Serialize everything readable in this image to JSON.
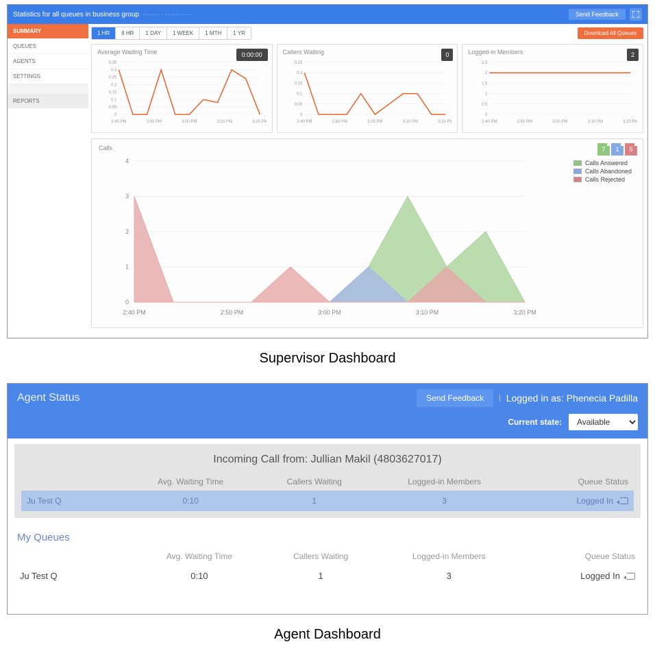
{
  "supervisor": {
    "header_title": "Statistics for all queues in business group",
    "send_feedback": "Send Feedback",
    "sidebar": {
      "summary": "SUMMARY",
      "queues": "QUEUES",
      "agents": "AGENTS",
      "settings": "SETTINGS",
      "reports": "REPORTS"
    },
    "ranges": [
      "1 HR",
      "8 HR",
      "1 DAY",
      "1 WEEK",
      "1 MTH",
      "1 YR"
    ],
    "active_range": 0,
    "download_btn": "Download All Queues",
    "cards": {
      "avg_wait": {
        "title": "Average Waiting Time",
        "badge": "0:00:00"
      },
      "callers_waiting": {
        "title": "Callers Waiting",
        "badge": "0"
      },
      "logged_in": {
        "title": "Logged-in Members",
        "badge": "2"
      }
    },
    "calls_card": {
      "title": "Calls",
      "badges": {
        "green": "7",
        "blue": "1",
        "red": "5"
      },
      "legend": {
        "answered": "Calls Answered",
        "abandoned": "Calls Abandoned",
        "rejected": "Calls Rejected"
      }
    }
  },
  "captions": {
    "supervisor": "Supervisor Dashboard",
    "agent": "Agent Dashboard"
  },
  "agent": {
    "title": "Agent Status",
    "send_feedback": "Send Feedback",
    "logged_in_as_label": "Logged in as:",
    "logged_in_as_name": "Phenecia Padilla",
    "state_label": "Current state:",
    "state_value": "Available",
    "incoming": "Incoming Call from: Jullian Makil (4803627017)",
    "cols": {
      "name": "",
      "avg": "Avg. Waiting Time",
      "callers": "Callers Waiting",
      "members": "Logged-in Members",
      "status": "Queue Status"
    },
    "hl_row": {
      "name": "Ju Test Q",
      "avg": "0:10",
      "callers": "1",
      "members": "3",
      "status": "Logged In"
    },
    "my_queues_title": "My Queues",
    "q_row": {
      "name": "Ju Test Q",
      "avg": "0:10",
      "callers": "1",
      "members": "3",
      "status": "Logged In"
    }
  },
  "chart_data": [
    {
      "type": "line",
      "name": "avg_waiting_time",
      "title": "Average Waiting Time",
      "ylabel": "",
      "xlabel": "",
      "ylim": [
        0,
        0.35
      ],
      "y_ticks": [
        0,
        0.05,
        0.1,
        0.15,
        0.2,
        0.25,
        0.3,
        0.35
      ],
      "x_time_labels": [
        "2:40 PM",
        "2:50 PM",
        "3:00 PM",
        "3:10 PM",
        "3:20 PM"
      ],
      "series": [
        {
          "name": "avg_wait",
          "color": "#e8622b",
          "x": [
            0,
            1,
            2,
            3,
            4,
            5,
            6,
            7,
            8,
            9,
            10
          ],
          "values": [
            0.3,
            0.0,
            0.0,
            0.3,
            0.0,
            0.0,
            0.1,
            0.08,
            0.3,
            0.24,
            0.0
          ]
        }
      ]
    },
    {
      "type": "line",
      "name": "callers_waiting",
      "title": "Callers Waiting",
      "ylabel": "",
      "xlabel": "",
      "ylim": [
        0,
        0.25
      ],
      "y_ticks": [
        0,
        0.05,
        0.1,
        0.15,
        0.2,
        0.25
      ],
      "x_time_labels": [
        "2:40 PM",
        "2:50 PM",
        "3:00 PM",
        "3:10 PM",
        "3:20 PM"
      ],
      "series": [
        {
          "name": "callers",
          "color": "#e8622b",
          "x": [
            0,
            1,
            2,
            3,
            4,
            5,
            6,
            7,
            8,
            9,
            10
          ],
          "values": [
            0.2,
            0.0,
            0.0,
            0.0,
            0.1,
            0.0,
            0.05,
            0.1,
            0.1,
            0.0,
            0.0
          ]
        }
      ]
    },
    {
      "type": "line",
      "name": "logged_in_members",
      "title": "Logged-in Members",
      "ylabel": "",
      "xlabel": "",
      "ylim": [
        0,
        2.5
      ],
      "y_ticks": [
        0,
        0.5,
        1.0,
        1.5,
        2.0,
        2.5
      ],
      "x_time_labels": [
        "2:40 PM",
        "2:50 PM",
        "3:00 PM",
        "3:10 PM",
        "3:20 PM"
      ],
      "series": [
        {
          "name": "members",
          "color": "#e8622b",
          "x": [
            0,
            1,
            2,
            3,
            4,
            5,
            6,
            7,
            8,
            9,
            10
          ],
          "values": [
            2,
            2,
            2,
            2,
            2,
            2,
            2,
            2,
            2,
            2,
            2
          ]
        }
      ]
    },
    {
      "type": "area",
      "name": "calls",
      "title": "Calls",
      "ylabel": "",
      "xlabel": "",
      "ylim": [
        0,
        4
      ],
      "y_ticks": [
        0,
        1,
        2,
        3,
        4
      ],
      "x_time_labels": [
        "2:40 PM",
        "2:50 PM",
        "3:00 PM",
        "3:10 PM",
        "3:20 PM"
      ],
      "categories_x": [
        0,
        1,
        2,
        3,
        4,
        5,
        6,
        7,
        8,
        9,
        10
      ],
      "series": [
        {
          "name": "Calls Answered",
          "color": "#aad39a",
          "values": [
            0,
            0,
            0,
            0,
            0,
            0,
            1,
            3,
            1,
            2,
            0
          ]
        },
        {
          "name": "Calls Abandoned",
          "color": "#a8b9e6",
          "values": [
            0,
            0,
            0,
            0,
            0,
            0,
            1,
            0,
            0,
            0,
            0
          ]
        },
        {
          "name": "Calls Rejected",
          "color": "#e6a8a8",
          "values": [
            3,
            0,
            0,
            0,
            1,
            0,
            0,
            0,
            1,
            0,
            0
          ]
        }
      ]
    }
  ]
}
